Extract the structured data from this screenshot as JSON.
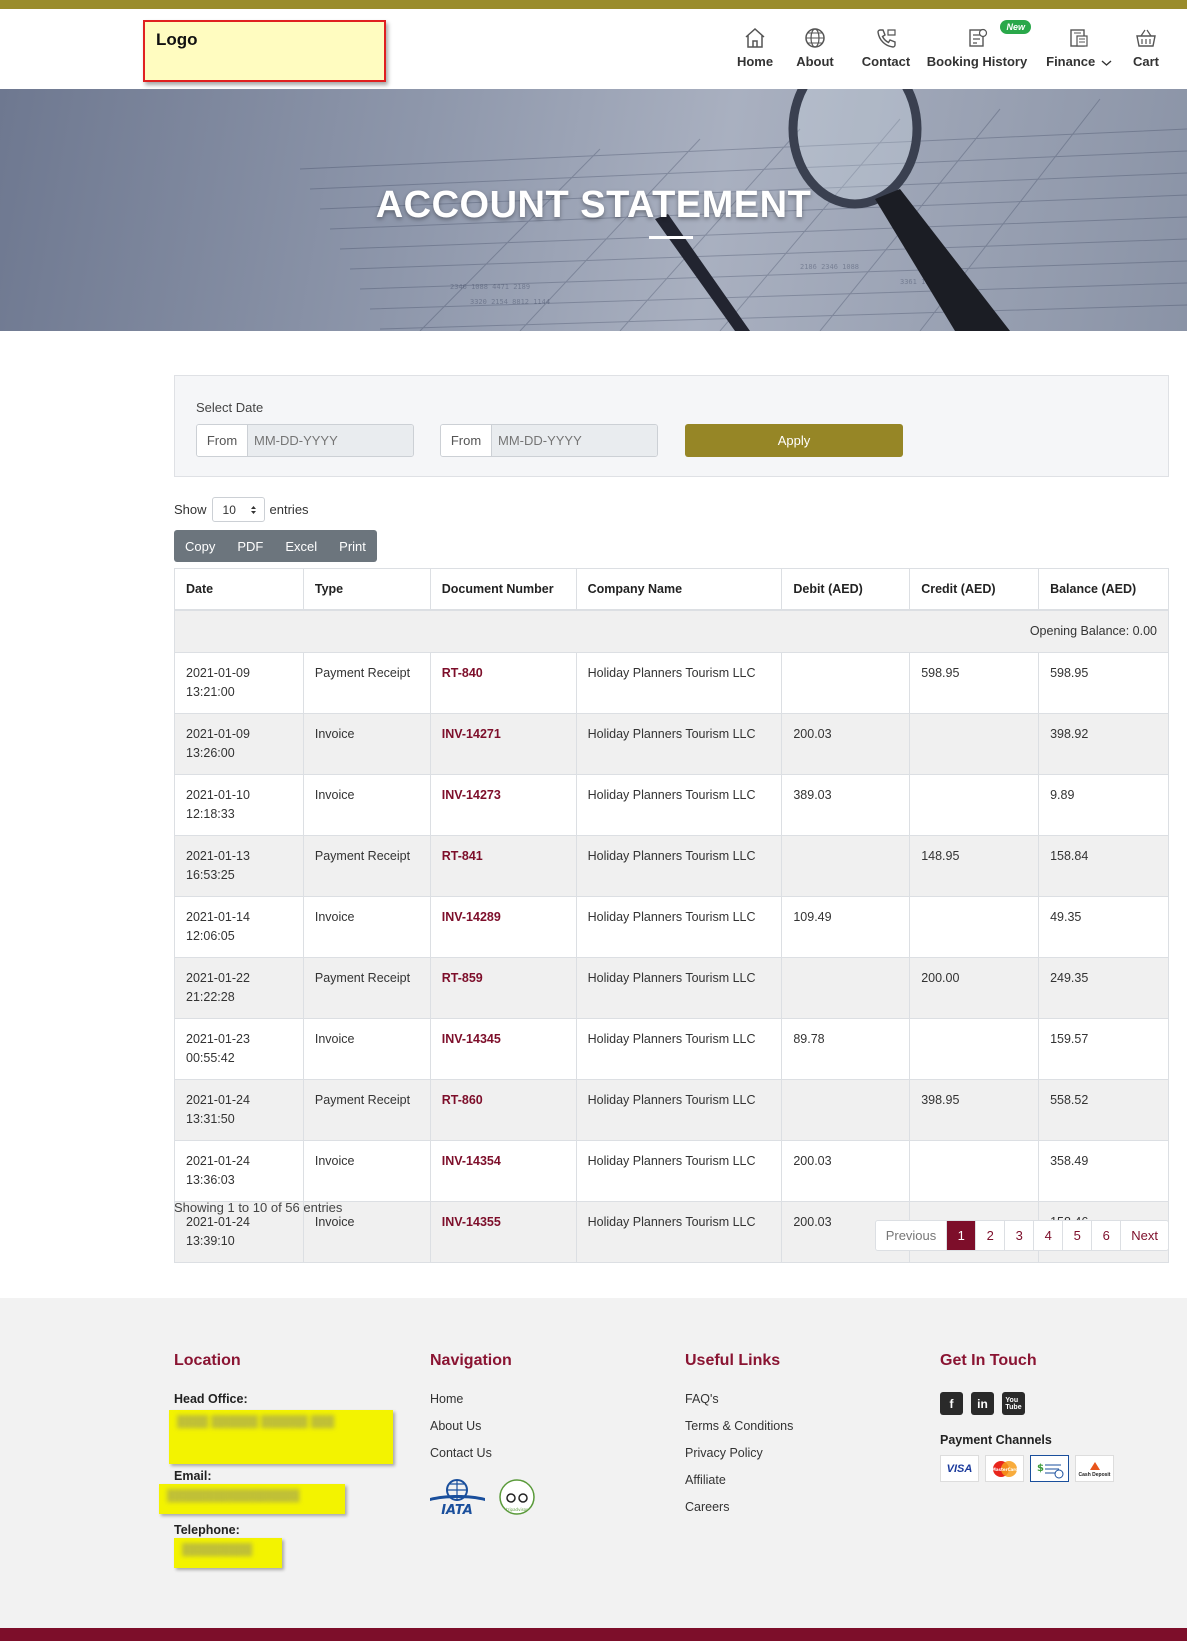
{
  "header": {
    "logo_text": "Logo",
    "nav": [
      {
        "label": "Home",
        "icon": "home-icon"
      },
      {
        "label": "About",
        "icon": "globe-icon"
      },
      {
        "label": "Contact",
        "icon": "phone-icon"
      },
      {
        "label": "Booking History",
        "icon": "booking-history-icon",
        "badge": "New"
      },
      {
        "label": "Finance",
        "icon": "finance-icon"
      },
      {
        "label": "Cart",
        "icon": "basket-icon"
      }
    ]
  },
  "hero": {
    "title": "ACCOUNT STATEMENT"
  },
  "filter": {
    "label": "Select Date",
    "from_label": "From",
    "from_placeholder": "MM-DD-YYYY",
    "to_label": "From",
    "to_placeholder": "MM-DD-YYYY",
    "apply_label": "Apply"
  },
  "entries": {
    "show": "Show",
    "value": "10",
    "suffix": "entries"
  },
  "export": {
    "copy": "Copy",
    "pdf": "PDF",
    "excel": "Excel",
    "print": "Print"
  },
  "table": {
    "columns": [
      "Date",
      "Type",
      "Document Number",
      "Company Name",
      "Debit (AED)",
      "Credit (AED)",
      "Balance (AED)"
    ],
    "opening": "Opening Balance: 0.00",
    "rows": [
      {
        "date": "2021-01-09 13:21:00",
        "type": "Payment Receipt",
        "doc": "RT-840",
        "company": "Holiday Planners Tourism LLC",
        "debit": "",
        "credit": "598.95",
        "balance": "598.95"
      },
      {
        "date": "2021-01-09 13:26:00",
        "type": "Invoice",
        "doc": "INV-14271",
        "company": "Holiday Planners Tourism LLC",
        "debit": "200.03",
        "credit": "",
        "balance": "398.92"
      },
      {
        "date": "2021-01-10 12:18:33",
        "type": "Invoice",
        "doc": "INV-14273",
        "company": "Holiday Planners Tourism LLC",
        "debit": "389.03",
        "credit": "",
        "balance": "9.89"
      },
      {
        "date": "2021-01-13 16:53:25",
        "type": "Payment Receipt",
        "doc": "RT-841",
        "company": "Holiday Planners Tourism LLC",
        "debit": "",
        "credit": "148.95",
        "balance": "158.84"
      },
      {
        "date": "2021-01-14 12:06:05",
        "type": "Invoice",
        "doc": "INV-14289",
        "company": "Holiday Planners Tourism LLC",
        "debit": "109.49",
        "credit": "",
        "balance": "49.35"
      },
      {
        "date": "2021-01-22 21:22:28",
        "type": "Payment Receipt",
        "doc": "RT-859",
        "company": "Holiday Planners Tourism LLC",
        "debit": "",
        "credit": "200.00",
        "balance": "249.35"
      },
      {
        "date": "2021-01-23 00:55:42",
        "type": "Invoice",
        "doc": "INV-14345",
        "company": "Holiday Planners Tourism LLC",
        "debit": "89.78",
        "credit": "",
        "balance": "159.57"
      },
      {
        "date": "2021-01-24 13:31:50",
        "type": "Payment Receipt",
        "doc": "RT-860",
        "company": "Holiday Planners Tourism LLC",
        "debit": "",
        "credit": "398.95",
        "balance": "558.52"
      },
      {
        "date": "2021-01-24 13:36:03",
        "type": "Invoice",
        "doc": "INV-14354",
        "company": "Holiday Planners Tourism LLC",
        "debit": "200.03",
        "credit": "",
        "balance": "358.49"
      },
      {
        "date": "2021-01-24 13:39:10",
        "type": "Invoice",
        "doc": "INV-14355",
        "company": "Holiday Planners Tourism LLC",
        "debit": "200.03",
        "credit": "",
        "balance": "158.46"
      }
    ]
  },
  "pagination": {
    "showing": "Showing 1 to 10 of 56 entries",
    "previous": "Previous",
    "pages": [
      "1",
      "2",
      "3",
      "4",
      "5",
      "6"
    ],
    "active": "1",
    "next": "Next"
  },
  "footer": {
    "location": {
      "title": "Location",
      "head_office_label": "Head Office:",
      "email_label": "Email:",
      "telephone_label": "Telephone:"
    },
    "navigation": {
      "title": "Navigation",
      "links": [
        "Home",
        "About Us",
        "Contact Us"
      ],
      "logos": [
        "IATA",
        "tripadvisor"
      ]
    },
    "useful_links": {
      "title": "Useful Links",
      "links": [
        "FAQ's",
        "Terms & Conditions",
        "Privacy Policy",
        "Affiliate",
        "Careers"
      ]
    },
    "get_in_touch": {
      "title": "Get In Touch",
      "social": [
        "facebook-icon",
        "linkedin-icon",
        "youtube-icon"
      ],
      "payment_title": "Payment Channels",
      "payment": [
        "VISA",
        "MasterCard",
        "cheque-icon",
        "Cash Deposit"
      ]
    }
  },
  "colors": {
    "accent": "#968626",
    "brand": "#7d0e2a",
    "highlight": "#f3f300"
  }
}
